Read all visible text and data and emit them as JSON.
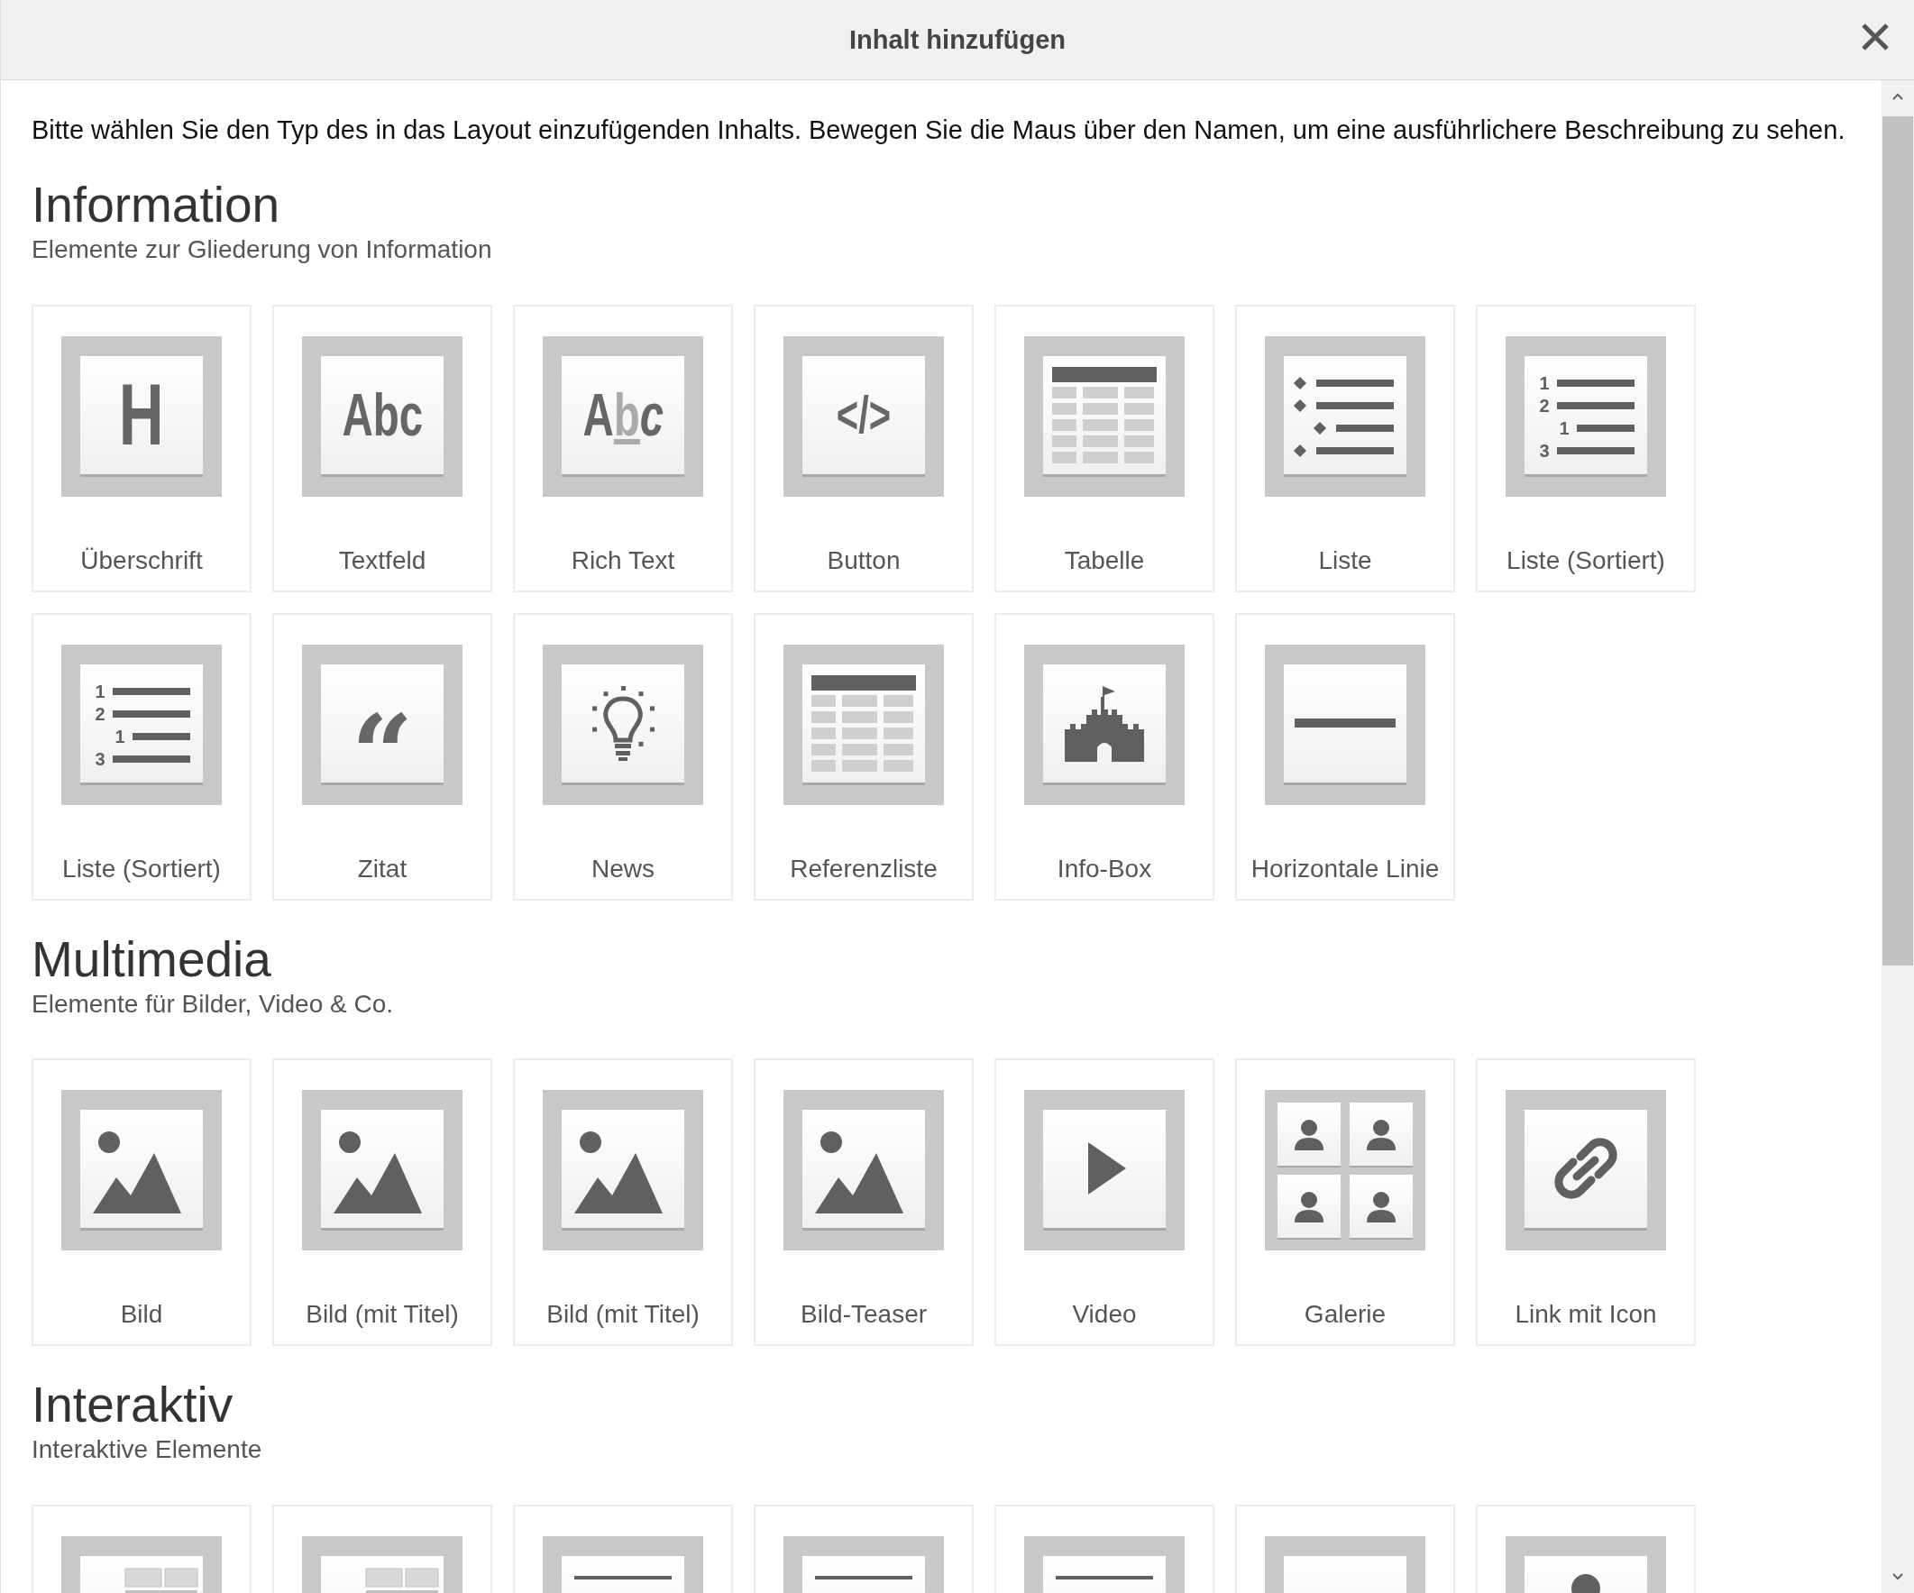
{
  "dialog": {
    "title": "Inhalt hinzufügen"
  },
  "intro": "Bitte wählen Sie den Typ des in das Layout einzufügenden Inhalts. Bewegen Sie die Maus über den Namen, um eine ausführlichere Beschreibung zu sehen.",
  "sections": [
    {
      "title": "Information",
      "subtitle": "Elemente zur Gliederung von Information",
      "items": [
        {
          "label": "Überschrift",
          "kind": "heading",
          "glyph": "H"
        },
        {
          "label": "Textfeld",
          "kind": "text",
          "glyph": "Abc"
        },
        {
          "label": "Rich Text",
          "kind": "richtext",
          "glyph": "Abc"
        },
        {
          "label": "Button",
          "kind": "code",
          "glyph": "</>"
        },
        {
          "label": "Tabelle",
          "kind": "table"
        },
        {
          "label": "Liste",
          "kind": "list"
        },
        {
          "label": "Liste (Sortiert)",
          "kind": "ordered",
          "numbers": [
            "1",
            "2",
            "1",
            "3"
          ]
        },
        {
          "label": "Liste (Sortiert)",
          "kind": "ordered",
          "numbers": [
            "1",
            "2",
            "1",
            "3"
          ]
        },
        {
          "label": "Zitat",
          "kind": "quote",
          "glyph": "“"
        },
        {
          "label": "News",
          "kind": "bulb"
        },
        {
          "label": "Referenzliste",
          "kind": "table"
        },
        {
          "label": "Info-Box",
          "kind": "castle"
        },
        {
          "label": "Horizontale Linie",
          "kind": "rule"
        }
      ]
    },
    {
      "title": "Multimedia",
      "subtitle": "Elemente für Bilder, Video & Co.",
      "items": [
        {
          "label": "Bild",
          "kind": "image"
        },
        {
          "label": "Bild (mit Titel)",
          "kind": "image"
        },
        {
          "label": "Bild (mit Titel)",
          "kind": "image"
        },
        {
          "label": "Bild-Teaser",
          "kind": "image"
        },
        {
          "label": "Video",
          "kind": "play"
        },
        {
          "label": "Galerie",
          "kind": "gallery"
        },
        {
          "label": "Link mit Icon",
          "kind": "link"
        }
      ]
    },
    {
      "title": "Interaktiv",
      "subtitle": "Interaktive Elemente",
      "items": [
        {
          "kind": "layout"
        },
        {
          "kind": "layout"
        },
        {
          "kind": "topline"
        },
        {
          "kind": "topline"
        },
        {
          "kind": "topline"
        },
        {
          "kind": "blank"
        },
        {
          "kind": "dot"
        }
      ]
    }
  ]
}
